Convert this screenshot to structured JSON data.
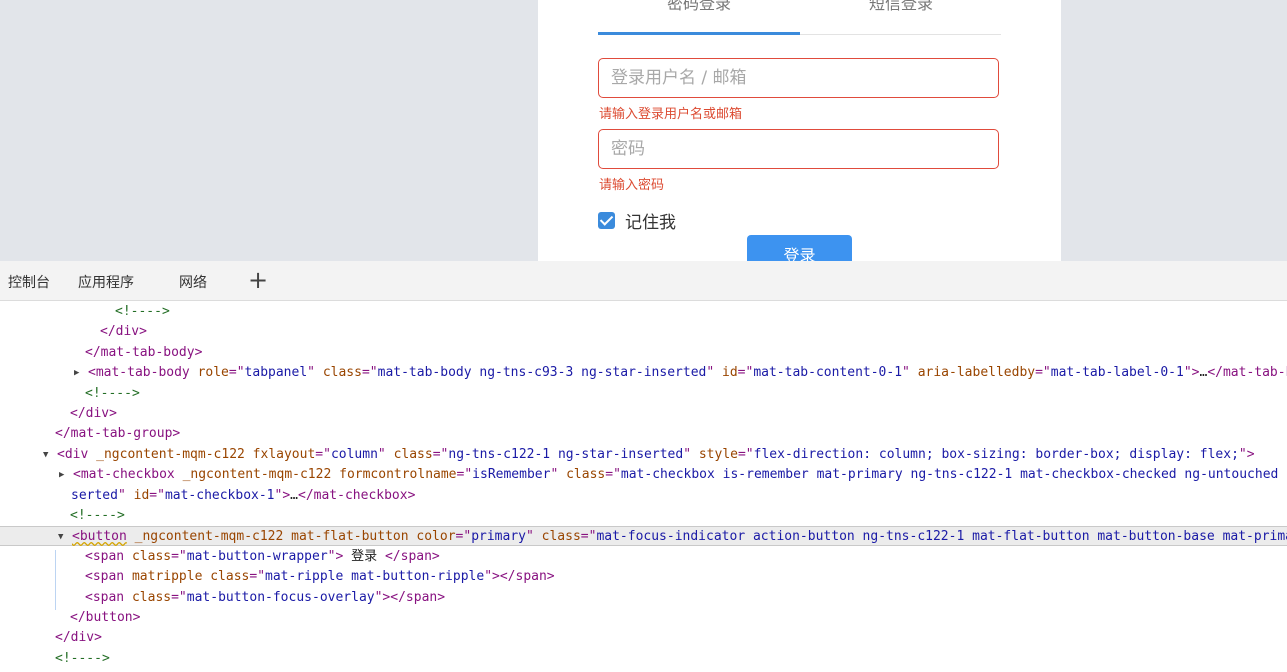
{
  "login": {
    "tabs": [
      "密码登录",
      "短信登录"
    ],
    "username_placeholder": "登录用户名 / 邮箱",
    "username_error": "请输入登录用户名或邮箱",
    "password_placeholder": "密码",
    "password_error": "请输入密码",
    "remember_label": "记住我",
    "remember_checked": true,
    "submit_label": "登录"
  },
  "devtools": {
    "tabs": [
      "控制台",
      "应用程序",
      "网络"
    ],
    "add_tab": "+",
    "lines": [
      {
        "indent": 115,
        "tri": "",
        "segs": [
          [
            "cm",
            "<!---->"
          ]
        ]
      },
      {
        "indent": 100,
        "tri": "",
        "segs": [
          [
            "tg",
            "</div>"
          ]
        ]
      },
      {
        "indent": 85,
        "tri": "",
        "segs": [
          [
            "tg",
            "</mat-tab-body>"
          ]
        ]
      },
      {
        "indent": 88,
        "tri": "▶",
        "segs": [
          [
            "tg",
            "<mat-tab-body "
          ],
          [
            "an",
            "role"
          ],
          [
            "tg",
            "=\""
          ],
          [
            "av",
            "tabpanel"
          ],
          [
            "tg",
            "\" "
          ],
          [
            "an",
            "class"
          ],
          [
            "tg",
            "=\""
          ],
          [
            "av",
            "mat-tab-body ng-tns-c93-3 ng-star-inserted"
          ],
          [
            "tg",
            "\" "
          ],
          [
            "an",
            "id"
          ],
          [
            "tg",
            "=\""
          ],
          [
            "av",
            "mat-tab-content-0-1"
          ],
          [
            "tg",
            "\" "
          ],
          [
            "an",
            "aria-labelledby"
          ],
          [
            "tg",
            "=\""
          ],
          [
            "av",
            "mat-tab-label-0-1"
          ],
          [
            "tg",
            "\">"
          ],
          [
            "tx",
            "…"
          ],
          [
            "tg",
            "</mat-tab-body>"
          ]
        ]
      },
      {
        "indent": 85,
        "tri": "",
        "segs": [
          [
            "cm",
            "<!---->"
          ]
        ]
      },
      {
        "indent": 70,
        "tri": "",
        "segs": [
          [
            "tg",
            "</div>"
          ]
        ]
      },
      {
        "indent": 55,
        "tri": "",
        "segs": [
          [
            "tg",
            "</mat-tab-group>"
          ]
        ]
      },
      {
        "indent": 57,
        "tri": "▼",
        "segs": [
          [
            "tg",
            "<div "
          ],
          [
            "an",
            "_ngcontent-mqm-c122 fxlayout"
          ],
          [
            "tg",
            "=\""
          ],
          [
            "av",
            "column"
          ],
          [
            "tg",
            "\" "
          ],
          [
            "an",
            "class"
          ],
          [
            "tg",
            "=\""
          ],
          [
            "av",
            "ng-tns-c122-1 ng-star-inserted"
          ],
          [
            "tg",
            "\" "
          ],
          [
            "an",
            "style"
          ],
          [
            "tg",
            "=\""
          ],
          [
            "av",
            "flex-direction: column; box-sizing: border-box; display: flex;"
          ],
          [
            "tg",
            "\">"
          ]
        ]
      },
      {
        "indent": 73,
        "tri": "▶",
        "segs": [
          [
            "tg",
            "<mat-checkbox "
          ],
          [
            "an",
            "_ngcontent-mqm-c122 formcontrolname"
          ],
          [
            "tg",
            "=\""
          ],
          [
            "av",
            "isRemember"
          ],
          [
            "tg",
            "\" "
          ],
          [
            "an",
            "class"
          ],
          [
            "tg",
            "=\""
          ],
          [
            "av",
            "mat-checkbox is-remember mat-primary ng-tns-c122-1 mat-checkbox-checked ng-untouched ng-pristine ng-valid ng-star-in"
          ]
        ]
      },
      {
        "indent": 71,
        "tri": "",
        "segs": [
          [
            "av",
            "serted"
          ],
          [
            "tg",
            "\" "
          ],
          [
            "an",
            "id"
          ],
          [
            "tg",
            "=\""
          ],
          [
            "av",
            "mat-checkbox-1"
          ],
          [
            "tg",
            "\">"
          ],
          [
            "tx",
            "…"
          ],
          [
            "tg",
            "</mat-checkbox>"
          ]
        ]
      },
      {
        "indent": 70,
        "tri": "",
        "segs": [
          [
            "cm",
            "<!---->"
          ]
        ]
      },
      {
        "indent": 72,
        "tri": "▼",
        "sel": true,
        "segs": [
          [
            "tg squig",
            "<button"
          ],
          [
            "an",
            " _ngcontent-mqm-c122 mat-flat-button "
          ],
          [
            "an",
            "color"
          ],
          [
            "tg",
            "=\""
          ],
          [
            "av",
            "primary"
          ],
          [
            "tg",
            "\" "
          ],
          [
            "an",
            "class"
          ],
          [
            "tg",
            "=\""
          ],
          [
            "av",
            "mat-focus-indicator action-button ng-tns-c122-1 mat-flat-button mat-button-base mat-primary"
          ],
          [
            "tg",
            "\">"
          ]
        ]
      },
      {
        "indent": 85,
        "tri": "",
        "segs": [
          [
            "tg",
            "<span "
          ],
          [
            "an",
            "class"
          ],
          [
            "tg",
            "=\""
          ],
          [
            "av",
            "mat-button-wrapper"
          ],
          [
            "tg",
            "\">"
          ],
          [
            "tx",
            " 登录 "
          ],
          [
            "tg",
            "</span>"
          ]
        ]
      },
      {
        "indent": 85,
        "tri": "",
        "segs": [
          [
            "tg",
            "<span "
          ],
          [
            "an",
            "matripple class"
          ],
          [
            "tg",
            "=\""
          ],
          [
            "av",
            "mat-ripple mat-button-ripple"
          ],
          [
            "tg",
            "\">"
          ],
          [
            "tg",
            "</span>"
          ]
        ]
      },
      {
        "indent": 85,
        "tri": "",
        "segs": [
          [
            "tg",
            "<span "
          ],
          [
            "an",
            "class"
          ],
          [
            "tg",
            "=\""
          ],
          [
            "av",
            "mat-button-focus-overlay"
          ],
          [
            "tg",
            "\">"
          ],
          [
            "tg",
            "</span>"
          ]
        ]
      },
      {
        "indent": 70,
        "tri": "",
        "segs": [
          [
            "tg",
            "</button>"
          ]
        ]
      },
      {
        "indent": 55,
        "tri": "",
        "segs": [
          [
            "tg",
            "</div>"
          ]
        ]
      },
      {
        "indent": 55,
        "tri": "",
        "segs": [
          [
            "cm",
            "<!---->"
          ]
        ]
      }
    ]
  }
}
